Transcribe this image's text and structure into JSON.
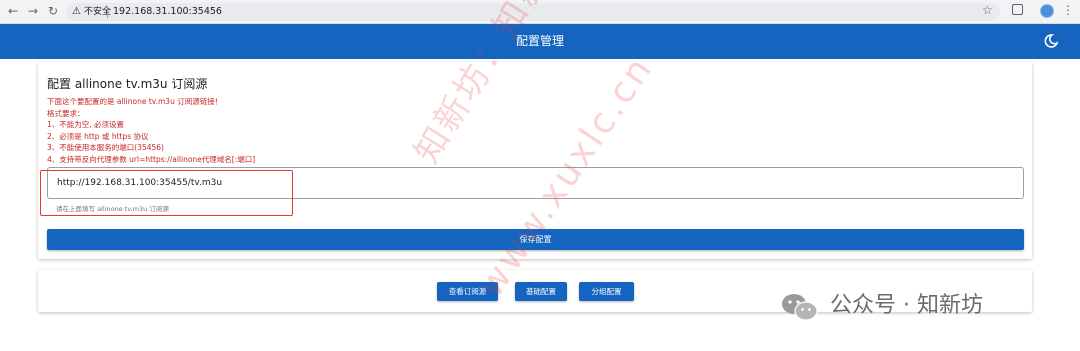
{
  "browser": {
    "insecure_label": "不安全",
    "url": "192.168.31.100:35456"
  },
  "header": {
    "title": "配置管理"
  },
  "config": {
    "title": "配置 allinone tv.m3u 订阅源",
    "description": [
      "下面这个要配置的是 allinone tv.m3u 订阅源链接！",
      "格式要求：",
      "1、不能为空, 必须设置",
      "2、必须是 http 或 https 协议",
      "3、不能使用本服务的端口(35456)",
      "4、支持带反向代理参数 url=https://allinone代理域名[:端口]"
    ],
    "input_value": "http://192.168.31.100:35455/tv.m3u",
    "hint": "请在上面填写 allinone tv.m3u 订阅源",
    "save_label": "保存配置"
  },
  "actions": {
    "view_sources": "查看订阅源",
    "basic_config": "基础配置",
    "group_config": "分组配置"
  },
  "watermark": {
    "line1": "知新坊：知新坊",
    "line2": "www.xuxlc.cn",
    "footer": "公众号 · 知新坊"
  },
  "colors": {
    "primary": "#1565c0",
    "warning_text": "#c62828",
    "highlight_box": "#e53935"
  }
}
